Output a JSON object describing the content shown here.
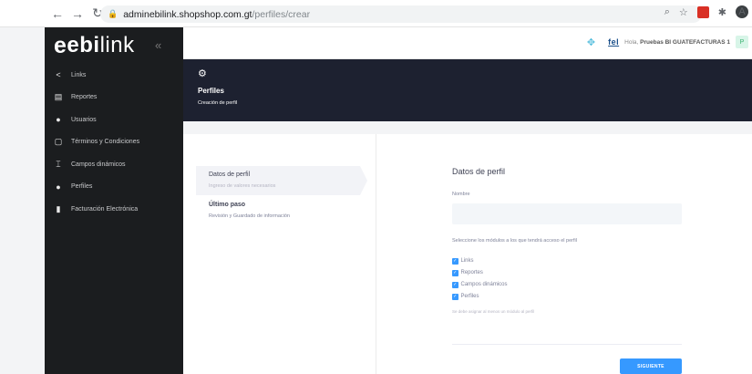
{
  "browser": {
    "url_host": "adminebilink.shopshop.com.gt",
    "url_path": "/perfiles/crear"
  },
  "sidebar": {
    "logo_mark": "e",
    "logo_bold": "ebi",
    "logo_light": "link",
    "items": [
      {
        "label": "Links",
        "icon": "share-icon"
      },
      {
        "label": "Reportes",
        "icon": "chart-icon"
      },
      {
        "label": "Usuarios",
        "icon": "users-icon"
      },
      {
        "label": "Términos y Condiciones",
        "icon": "document-icon"
      },
      {
        "label": "Campos dinámicos",
        "icon": "fields-icon"
      },
      {
        "label": "Perfiles",
        "icon": "profiles-icon"
      },
      {
        "label": "Facturación Electrónica",
        "icon": "invoice-icon"
      }
    ]
  },
  "topbar": {
    "fel_logo": "fel",
    "greeting_prefix": "Hola,",
    "user_name": "Pruebas BI GUATEFACTURAS 1",
    "user_initial": "P"
  },
  "header": {
    "title": "Perfiles",
    "subtitle": "Creación de perfil"
  },
  "steps": [
    {
      "title": "Datos de perfil",
      "description": "Ingreso de valores necesarios"
    },
    {
      "title": "Último paso",
      "description": "Revisión y Guardado de información"
    }
  ],
  "form": {
    "title": "Datos de perfil",
    "name_label": "Nombre",
    "name_value": "",
    "modules_label": "Seleccione los módulos a los que tendrá acceso el perfil",
    "modules": [
      {
        "label": "Links",
        "checked": true
      },
      {
        "label": "Reportes",
        "checked": true
      },
      {
        "label": "Campos dinámicos",
        "checked": true
      },
      {
        "label": "Perfiles",
        "checked": true
      }
    ],
    "hint": "Se debe asignar al menos un módulo al perfil",
    "next_label": "SIGUIENTE"
  },
  "colors": {
    "sidebar_bg": "#1b1d1f",
    "header_bg": "#1d2130",
    "accent": "#3699ff"
  }
}
